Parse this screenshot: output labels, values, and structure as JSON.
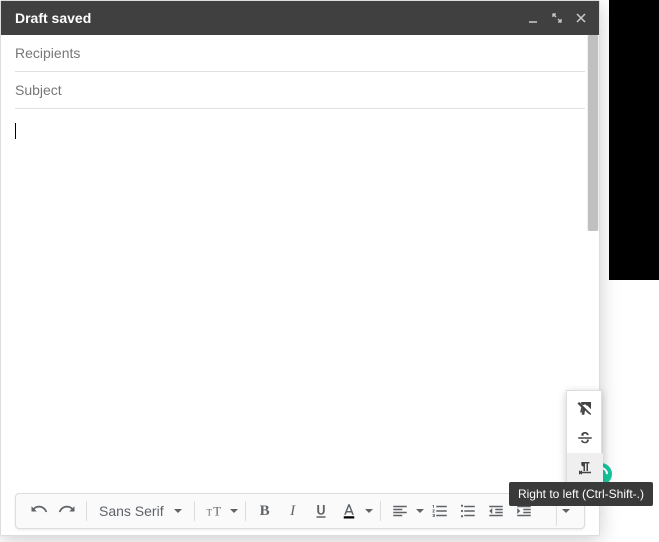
{
  "header": {
    "title": "Draft saved"
  },
  "fields": {
    "recipients_placeholder": "Recipients",
    "recipients_value": "",
    "subject_placeholder": "Subject",
    "subject_value": ""
  },
  "body": {
    "content": ""
  },
  "toolbar": {
    "font_label": "Sans Serif"
  },
  "popover": {
    "tooltip": "Right to left (Ctrl-Shift-.)"
  }
}
